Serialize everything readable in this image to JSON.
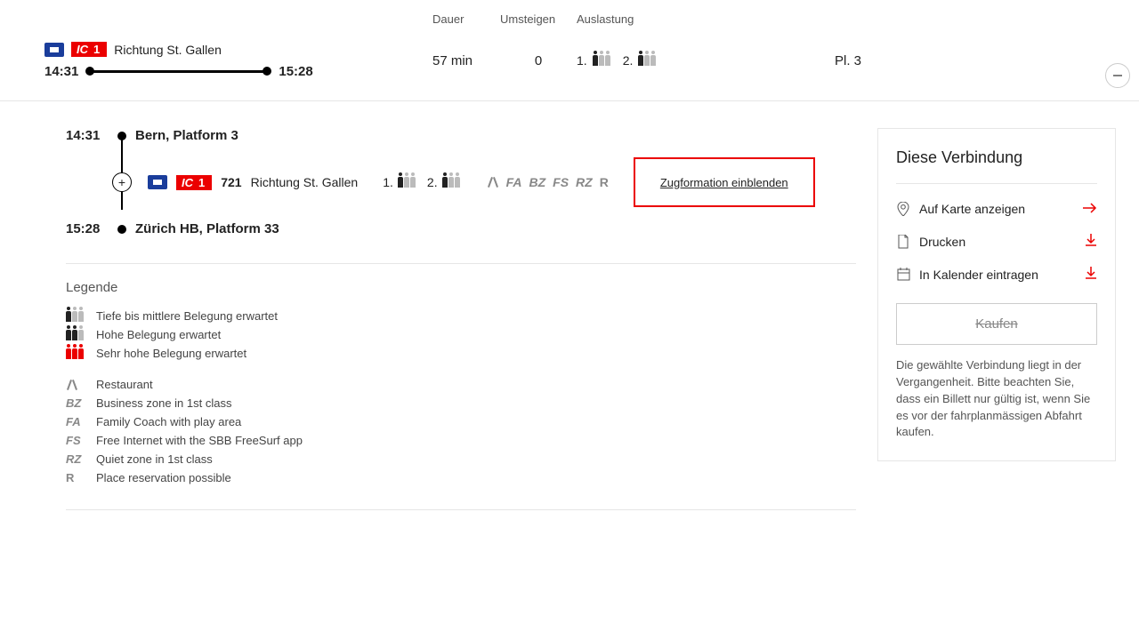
{
  "header": {
    "dauer_label": "Dauer",
    "umsteigen_label": "Umsteigen",
    "auslastung_label": "Auslastung"
  },
  "summary": {
    "ic_line": "IC",
    "ic_number": "1",
    "direction": "Richtung St. Gallen",
    "departure": "14:31",
    "arrival": "15:28",
    "duration": "57 min",
    "changes": "0",
    "occ_first_prefix": "1.",
    "occ_second_prefix": "2.",
    "platform": "Pl. 3"
  },
  "detail": {
    "dep_time": "14:31",
    "dep_station": "Bern, Platform 3",
    "arr_time": "15:28",
    "arr_station": "Zürich HB, Platform 33",
    "train_ic": "IC",
    "train_line": "1",
    "train_number": "721",
    "train_direction": "Richtung St. Gallen",
    "occ1": "1.",
    "occ2": "2.",
    "amenities": {
      "fa": "FA",
      "bz": "BZ",
      "fs": "FS",
      "rz": "RZ",
      "r": "R"
    },
    "formation_link": "Zugformation einblenden"
  },
  "legend": {
    "title": "Legende",
    "low": "Tiefe bis mittlere Belegung erwartet",
    "high": "Hohe Belegung erwartet",
    "very_high": "Sehr hohe Belegung erwartet",
    "restaurant": "Restaurant",
    "bz": "Business zone in 1st class",
    "fa": "Family Coach with play area",
    "fs": "Free Internet with the SBB FreeSurf app",
    "rz": "Quiet zone in 1st class",
    "r": "Place reservation possible",
    "bz_label": "BZ",
    "fa_label": "FA",
    "fs_label": "FS",
    "rz_label": "RZ",
    "r_label": "R"
  },
  "side": {
    "title": "Diese Verbindung",
    "show_map": "Auf Karte anzeigen",
    "print": "Drucken",
    "calendar": "In Kalender eintragen",
    "buy": "Kaufen",
    "note": "Die gewählte Verbindung liegt in der Vergangenheit. Bitte beachten Sie, dass ein Billett nur gültig ist, wenn Sie es vor der fahrplanmässigen Abfahrt kaufen."
  }
}
